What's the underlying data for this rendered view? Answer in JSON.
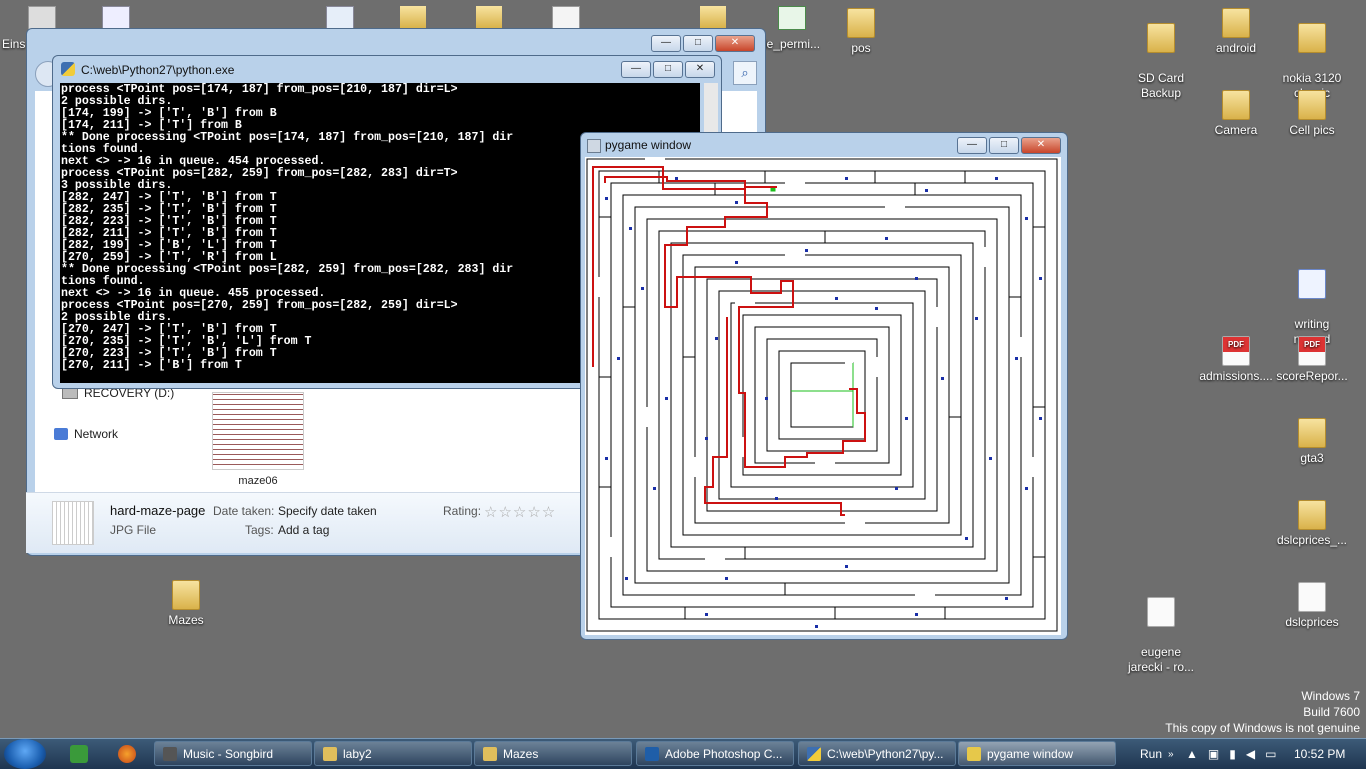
{
  "desktop": {
    "icons_right": [
      {
        "label": "SD Card\nBackup",
        "kind": "folder"
      },
      {
        "label": "android",
        "kind": "folder"
      },
      {
        "label": "nokia 3120\nclassic",
        "kind": "folder"
      },
      {
        "label": "Camera",
        "kind": "folder"
      },
      {
        "label": "Cell pics",
        "kind": "folder"
      },
      {
        "label": "writing\nnyu-ad",
        "kind": "word"
      },
      {
        "label": "admissions....",
        "kind": "pdf"
      },
      {
        "label": "scoreRepor...",
        "kind": "pdf"
      },
      {
        "label": "gta3",
        "kind": "folder"
      },
      {
        "label": "dslcprices_...",
        "kind": "folder"
      },
      {
        "label": "eugene\njarecki - ro...",
        "kind": "doc"
      },
      {
        "label": "dslcprices",
        "kind": "doc"
      }
    ],
    "icons_top": [
      {
        "label": "Eins"
      },
      {
        "label": "le_permi..."
      },
      {
        "label": "pos"
      }
    ],
    "mazes_folder": "Mazes"
  },
  "explorer": {
    "nav": {
      "recovery": "RECOVERY (D:)",
      "network": "Network"
    },
    "thumbnail_label": "maze06",
    "details": {
      "filename": "hard-maze-page",
      "filetype": "JPG File",
      "date_label": "Date taken:",
      "date_value": "Specify date taken",
      "tags_label": "Tags:",
      "tags_value": "Add a tag",
      "rating_label": "Rating:",
      "stars": "☆☆☆☆☆"
    }
  },
  "console": {
    "title": "C:\\web\\Python27\\python.exe",
    "lines": [
      "process <TPoint pos=[174, 187] from_pos=[210, 187] dir=L>",
      "2 possible dirs.",
      "[174, 199] -> ['T', 'B'] from B",
      "[174, 211] -> ['T'] from B",
      "** Done processing <TPoint pos=[174, 187] from_pos=[210, 187] dir",
      "tions found.",
      "next <> -> 16 in queue. 454 processed.",
      "process <TPoint pos=[282, 259] from_pos=[282, 283] dir=T>",
      "3 possible dirs.",
      "[282, 247] -> ['T', 'B'] from T",
      "[282, 235] -> ['T', 'B'] from T",
      "[282, 223] -> ['T', 'B'] from T",
      "[282, 211] -> ['T', 'B'] from T",
      "[282, 199] -> ['B', 'L'] from T",
      "[270, 259] -> ['T', 'R'] from L",
      "** Done processing <TPoint pos=[282, 259] from_pos=[282, 283] dir",
      "tions found.",
      "next <> -> 16 in queue. 455 processed.",
      "process <TPoint pos=[270, 259] from_pos=[282, 259] dir=L>",
      "2 possible dirs.",
      "[270, 247] -> ['T', 'B'] from T",
      "[270, 235] -> ['T', 'B', 'L'] from T",
      "[270, 223] -> ['T', 'B'] from T",
      "[270, 211] -> ['B'] from T"
    ]
  },
  "pygame": {
    "title": "pygame window"
  },
  "watermark": {
    "line1": "Windows 7",
    "line2": "Build 7600",
    "line3": "This copy of Windows is not genuine"
  },
  "taskbar": {
    "buttons": [
      {
        "label": "Music - Songbird",
        "active": false
      },
      {
        "label": "laby2",
        "active": false
      },
      {
        "label": "Mazes",
        "active": false
      },
      {
        "label": "Adobe Photoshop C...",
        "active": false
      },
      {
        "label": "C:\\web\\Python27\\py...",
        "active": false
      },
      {
        "label": "pygame window",
        "active": true
      }
    ],
    "run_label": "Run",
    "clock": "10:52 PM"
  },
  "colors": {
    "path": "#cc1111",
    "dots": "#1a2fa8",
    "accent": "#4f6b8b"
  }
}
